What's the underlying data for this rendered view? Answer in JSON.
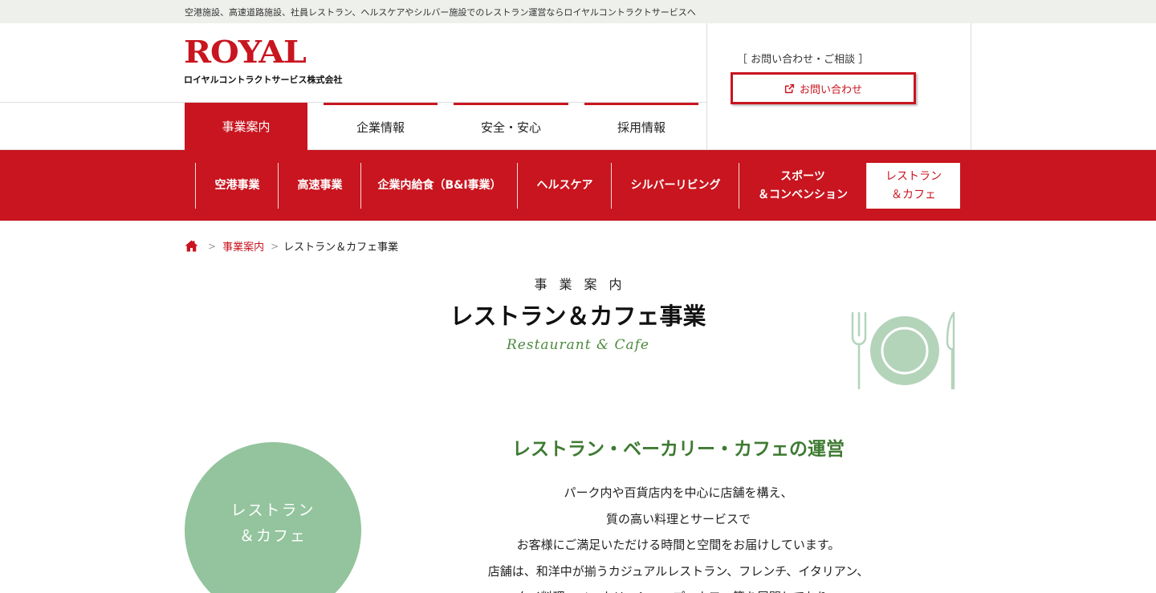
{
  "topbar": {
    "text": "空港施設、高速道路施設、社員レストラン、ヘルスケアやシルバー施設でのレストラン運営ならロイヤルコントラクトサービスへ"
  },
  "header": {
    "logo_text": "ROYAL",
    "logo_subtitle": "ロイヤルコントラクトサービス株式会社",
    "contact_label": "［ お問い合わせ・ご相談 ］",
    "contact_button": "お問い合わせ"
  },
  "nav": {
    "tabs": [
      {
        "label": "事業案内",
        "active": true
      },
      {
        "label": "企業情報",
        "active": false
      },
      {
        "label": "安全・安心",
        "active": false
      },
      {
        "label": "採用情報",
        "active": false
      }
    ]
  },
  "subnav": {
    "items": [
      {
        "label": "空港事業"
      },
      {
        "label": "高速事業"
      },
      {
        "label": "企業内給食（B&I事業）"
      },
      {
        "label": "ヘルスケア"
      },
      {
        "label": "シルバーリビング"
      },
      {
        "line1": "スポーツ",
        "line2": "＆コンベンション"
      },
      {
        "line1": "レストラン",
        "line2": "＆カフェ",
        "active": true
      }
    ]
  },
  "breadcrumb": {
    "separator": ">",
    "link": "事業案内",
    "current": "レストラン＆カフェ事業"
  },
  "page": {
    "kicker": "事業案内",
    "title": "レストラン＆カフェ事業",
    "subtitle": "Restaurant & Cafe"
  },
  "circle": {
    "line1": "レストラン",
    "line2": "＆カフェ"
  },
  "section": {
    "title": "レストラン・ベーカリー・カフェの運営",
    "lines": [
      "パーク内や百貨店内を中心に店舗を構え、",
      "質の高い料理とサービスで",
      "お客様にご満足いただける時間と空間をお届けしています。",
      "店舗は、和洋中が揃うカジュアルレストラン、フレンチ、イタリアン、",
      "タイ料理、ベーカリーショップ、カフェ等を展開しており、"
    ]
  },
  "colors": {
    "brand_red": "#c8151f",
    "accent_green": "#3e7a32",
    "circle_green": "#93c49d",
    "icon_green": "#b4d4ba"
  },
  "icons": {
    "home": "home-icon",
    "external": "external-link-icon",
    "plate": "plate-cutlery-icon"
  }
}
